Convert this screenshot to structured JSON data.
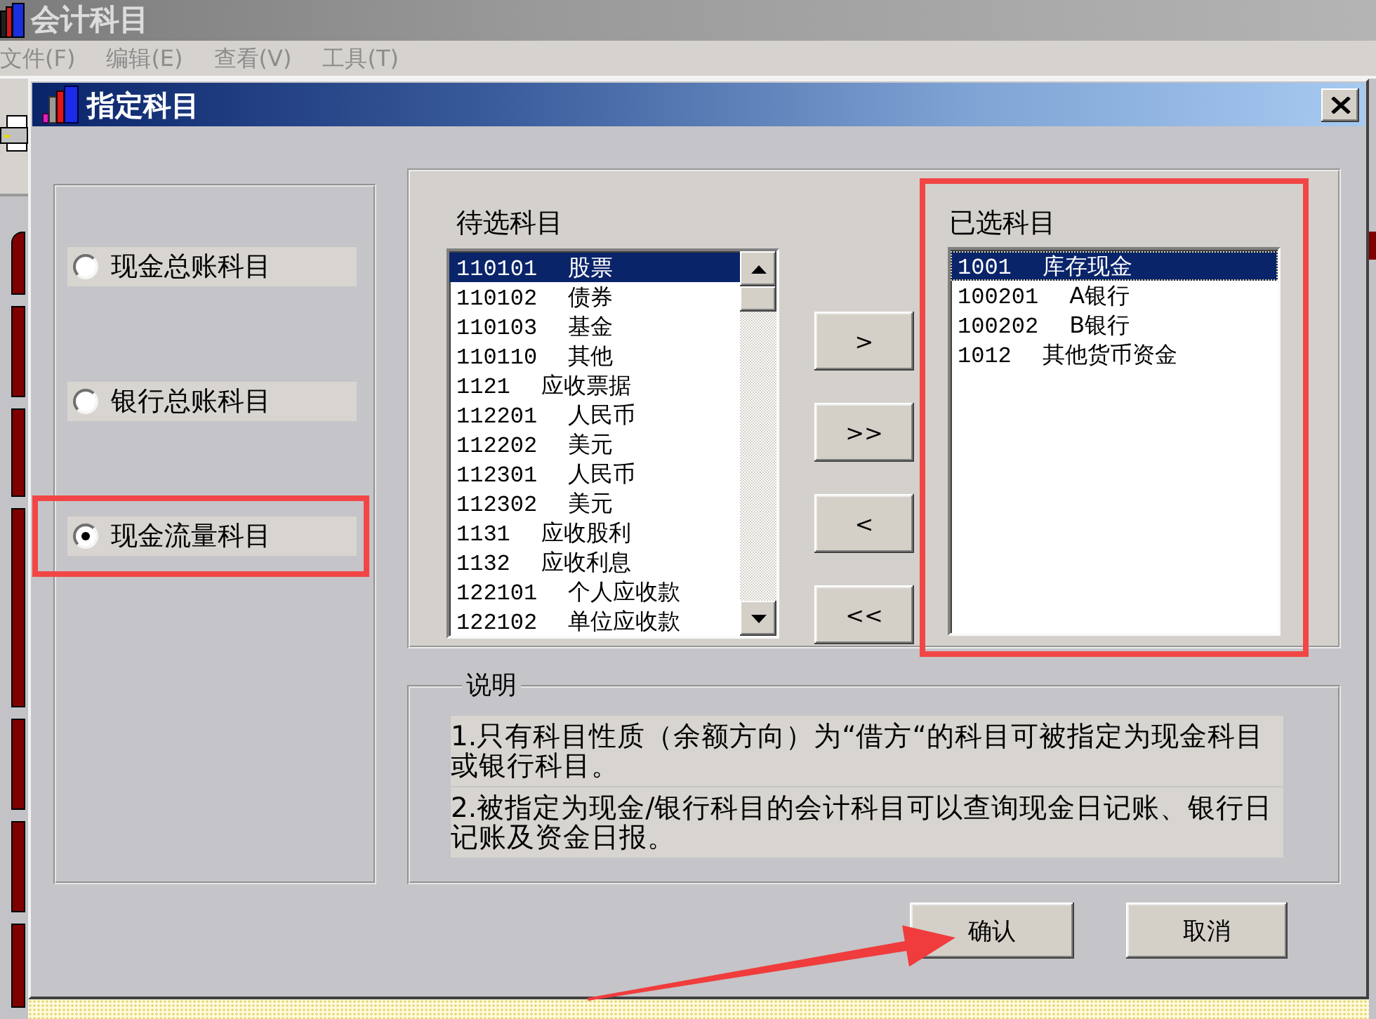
{
  "app_window": {
    "title": "会计科目",
    "menu": [
      {
        "label": "文件(F)",
        "disabled": true
      },
      {
        "label": "编辑(E)",
        "disabled": true
      },
      {
        "label": "查看(V)",
        "disabled": true
      },
      {
        "label": "工具(T)",
        "disabled": true
      }
    ]
  },
  "dialog": {
    "title": "指定科目",
    "options": [
      {
        "label": "现金总账科目",
        "selected": false
      },
      {
        "label": "银行总账科目",
        "selected": false
      },
      {
        "label": "现金流量科目",
        "selected": true
      }
    ],
    "available": {
      "label": "待选科目",
      "items": [
        {
          "code": "110101",
          "name": "股票",
          "selected": true
        },
        {
          "code": "110102",
          "name": "债券",
          "selected": false
        },
        {
          "code": "110103",
          "name": "基金",
          "selected": false
        },
        {
          "code": "110110",
          "name": "其他",
          "selected": false
        },
        {
          "code": "1121",
          "name": "应收票据",
          "selected": false
        },
        {
          "code": "112201",
          "name": "人民币",
          "selected": false
        },
        {
          "code": "112202",
          "name": "美元",
          "selected": false
        },
        {
          "code": "112301",
          "name": "人民币",
          "selected": false
        },
        {
          "code": "112302",
          "name": "美元",
          "selected": false
        },
        {
          "code": "1131",
          "name": "应收股利",
          "selected": false
        },
        {
          "code": "1132",
          "name": "应收利息",
          "selected": false
        },
        {
          "code": "122101",
          "name": "个人应收款",
          "selected": false
        },
        {
          "code": "122102",
          "name": "单位应收款",
          "selected": false
        }
      ]
    },
    "transfer_buttons": [
      ">",
      ">>",
      "<",
      "<<"
    ],
    "chosen": {
      "label": "已选科目",
      "items": [
        {
          "code": "1001",
          "name": "库存现金",
          "selected": true,
          "focused": true
        },
        {
          "code": "100201",
          "name": "A银行",
          "selected": false,
          "focused": false
        },
        {
          "code": "100202",
          "name": "B银行",
          "selected": false,
          "focused": false
        },
        {
          "code": "1012",
          "name": "其他货币资金",
          "selected": false,
          "focused": false
        }
      ]
    },
    "notes": {
      "title": "说明",
      "paragraphs": [
        "1.只有科目性质（余额方向）为“借方“的科目可被指定为现金科目或银行科目。",
        "2.被指定为现金/银行科目的会计科目可以查询现金日记账、银行日记账及资金日报。"
      ]
    },
    "buttons": [
      "确认",
      "取消"
    ]
  }
}
